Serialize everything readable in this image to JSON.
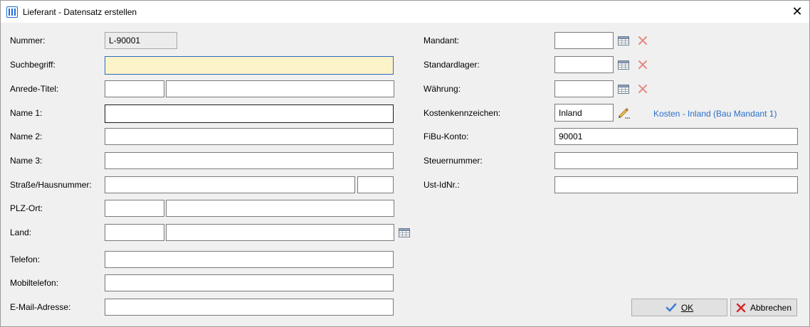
{
  "window": {
    "title": "Lieferant - Datensatz erstellen"
  },
  "left": {
    "nummer": {
      "label": "Nummer:",
      "value": "L-90001"
    },
    "suchbegriff": {
      "label": "Suchbegriff:",
      "value": ""
    },
    "anrede": {
      "label": "Anrede-Titel:",
      "value1": "",
      "value2": ""
    },
    "name1": {
      "label": "Name 1:",
      "value": ""
    },
    "name2": {
      "label": "Name 2:",
      "value": ""
    },
    "name3": {
      "label": "Name 3:",
      "value": ""
    },
    "strasse": {
      "label": "Straße/Hausnummer:",
      "value": "",
      "nr": ""
    },
    "plz": {
      "label": "PLZ-Ort:",
      "plz": "",
      "ort": ""
    },
    "land": {
      "label": "Land:",
      "code": "",
      "name": ""
    },
    "telefon": {
      "label": "Telefon:",
      "value": ""
    },
    "mobil": {
      "label": "Mobiltelefon:",
      "value": ""
    },
    "email": {
      "label": "E-Mail-Adresse:",
      "value": ""
    }
  },
  "right": {
    "mandant": {
      "label": "Mandant:",
      "value": ""
    },
    "standardlager": {
      "label": "Standardlager:",
      "value": ""
    },
    "waehrung": {
      "label": "Währung:",
      "value": ""
    },
    "kostenkennzeichen": {
      "label": "Kostenkennzeichen:",
      "value": "Inland",
      "info": "Kosten - Inland (Bau Mandant 1)"
    },
    "fibu": {
      "label": "FiBu-Konto:",
      "value": "90001"
    },
    "steuernummer": {
      "label": "Steuernummer:",
      "value": ""
    },
    "ustid": {
      "label": "Ust-IdNr.:",
      "value": ""
    }
  },
  "buttons": {
    "ok": "OK",
    "cancel": "Abbrechen"
  },
  "icons": {
    "lookup": "table-lookup-icon",
    "clear": "clear-x-icon",
    "edit": "pencil-icon"
  },
  "colors": {
    "active_field": "#fdf3c8",
    "link": "#2a6fc9",
    "checkmark": "#3a7bd5",
    "cancel_x": "#d9242b",
    "clear_x": "#e58a84"
  }
}
